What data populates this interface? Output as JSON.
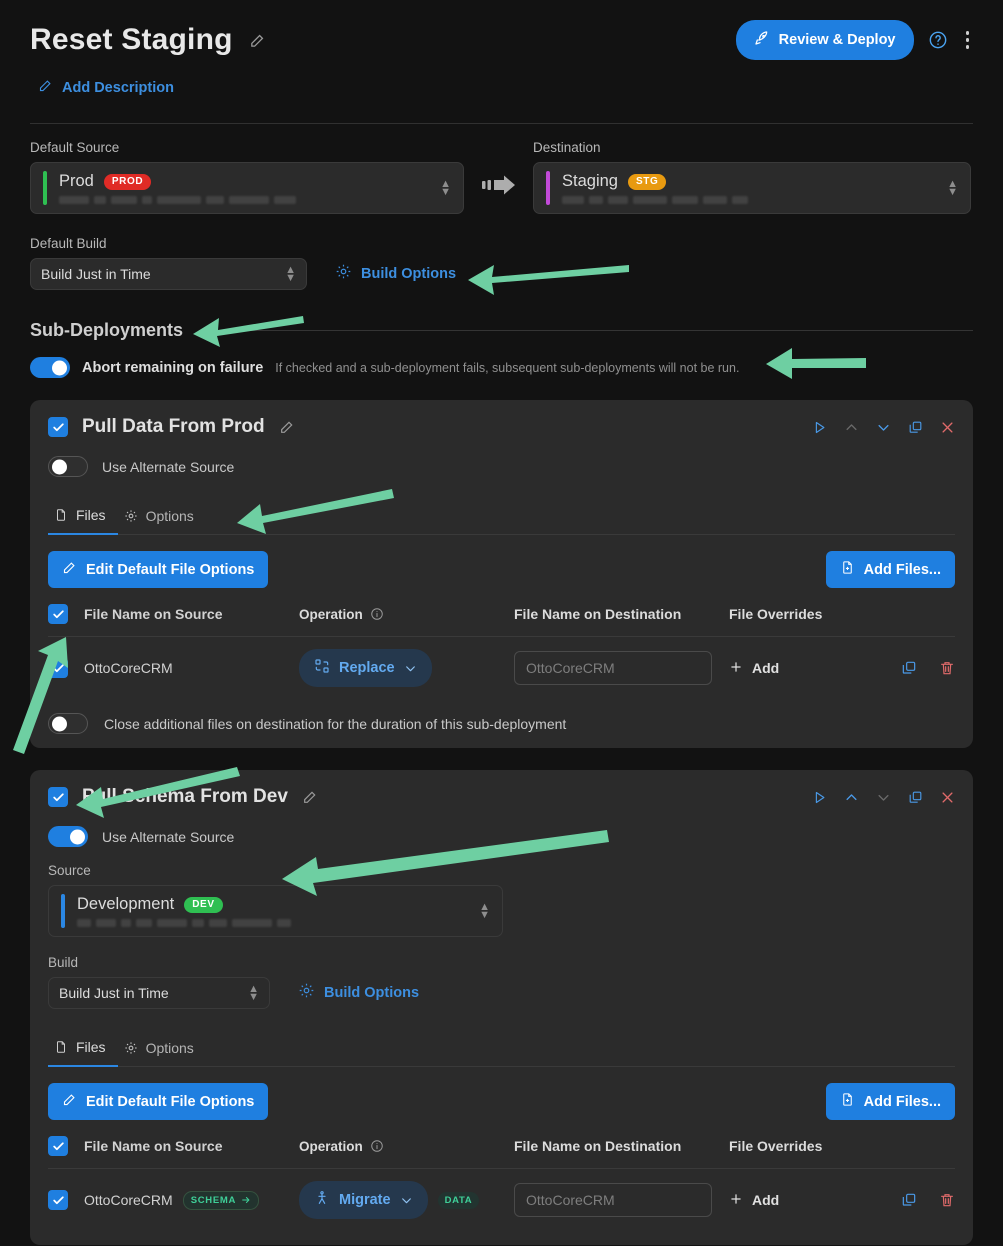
{
  "header": {
    "title": "Reset Staging",
    "edit_title_icon": "pencil-icon",
    "deploy_label": "Review & Deploy",
    "deploy_icon": "rocket-icon",
    "help_icon": "help-circle-icon",
    "menu_icon": "kebab-menu-icon",
    "add_description_label": "Add Description",
    "add_description_icon": "pencil-square-icon",
    "accent_color": "#1f7fe0"
  },
  "connection": {
    "source_label": "Default Source",
    "source": {
      "name": "Prod",
      "badge": "PROD",
      "badge_color": "#e02b26",
      "accent_color": "#2fbf52",
      "redacted": true
    },
    "arrow_icon": "arrow-right-motion-icon",
    "destination_label": "Destination",
    "destination": {
      "name": "Staging",
      "badge": "STG",
      "badge_color": "#e89a10",
      "accent_color": "#c24ad8",
      "redacted": true
    }
  },
  "default_build": {
    "label": "Default Build",
    "value": "Build Just in Time",
    "build_options_label": "Build Options",
    "build_options_icon": "gear-icon"
  },
  "sub_deployments": {
    "section_title": "Sub-Deployments",
    "abort": {
      "label": "Abort remaining on failure",
      "hint": "If checked and a sub-deployment fails, subsequent sub-deployments will not be run.",
      "enabled": true
    },
    "cards": [
      {
        "title": "Pull Data From Prod",
        "checked": true,
        "edit_icon": "pencil-icon",
        "actions": [
          {
            "name": "run-icon",
            "glyph": "play",
            "state": "enabled"
          },
          {
            "name": "move-up-icon",
            "glyph": "chevron-up",
            "state": "disabled"
          },
          {
            "name": "move-down-icon",
            "glyph": "chevron-down",
            "state": "enabled"
          },
          {
            "name": "duplicate-icon",
            "glyph": "copy",
            "state": "enabled"
          },
          {
            "name": "remove-icon",
            "glyph": "close",
            "state": "danger"
          }
        ],
        "alt_source": {
          "label": "Use Alternate Source",
          "enabled": false
        },
        "tabs": [
          {
            "label": "Files",
            "icon": "file-icon",
            "active": true
          },
          {
            "label": "Options",
            "icon": "gear-icon",
            "active": false
          }
        ],
        "edit_defaults_label": "Edit Default File Options",
        "edit_defaults_icon": "pencil-icon",
        "add_files_label": "Add Files...",
        "add_files_icon": "file-plus-icon",
        "table": {
          "header_checked": true,
          "columns": [
            "File Name on Source",
            "Operation",
            "File Name on Destination",
            "File Overrides"
          ],
          "operation_info_icon": "info-icon",
          "rows": [
            {
              "checked": true,
              "source_name": "OttoCoreCRM",
              "source_badge": null,
              "operation": "Replace",
              "operation_icon": "replace-icon",
              "operation_badge": null,
              "destination_placeholder": "OttoCoreCRM",
              "destination_value": "",
              "add_label": "Add",
              "add_icon": "plus-icon",
              "copy_icon": "copy-icon",
              "delete_icon": "trash-icon"
            }
          ]
        },
        "close_files": {
          "label": "Close additional files on destination for the duration of this sub-deployment",
          "enabled": false
        }
      },
      {
        "title": "Pull Schema From Dev",
        "checked": true,
        "edit_icon": "pencil-icon",
        "actions": [
          {
            "name": "run-icon",
            "glyph": "play",
            "state": "enabled"
          },
          {
            "name": "move-up-icon",
            "glyph": "chevron-up",
            "state": "enabled"
          },
          {
            "name": "move-down-icon",
            "glyph": "chevron-down",
            "state": "disabled"
          },
          {
            "name": "duplicate-icon",
            "glyph": "copy",
            "state": "enabled"
          },
          {
            "name": "remove-icon",
            "glyph": "close",
            "state": "danger"
          }
        ],
        "alt_source": {
          "label": "Use Alternate Source",
          "enabled": true
        },
        "source_label": "Source",
        "source": {
          "name": "Development",
          "badge": "DEV",
          "badge_color": "#2fbf52",
          "accent_color": "#2b87e3",
          "redacted": true
        },
        "build_label": "Build",
        "build_value": "Build Just in Time",
        "build_options_label": "Build Options",
        "build_options_icon": "gear-icon",
        "tabs": [
          {
            "label": "Files",
            "icon": "file-icon",
            "active": true
          },
          {
            "label": "Options",
            "icon": "gear-icon",
            "active": false
          }
        ],
        "edit_defaults_label": "Edit Default File Options",
        "edit_defaults_icon": "pencil-icon",
        "add_files_label": "Add Files...",
        "add_files_icon": "file-plus-icon",
        "table": {
          "header_checked": true,
          "columns": [
            "File Name on Source",
            "Operation",
            "File Name on Destination",
            "File Overrides"
          ],
          "operation_info_icon": "info-icon",
          "rows": [
            {
              "checked": true,
              "source_name": "OttoCoreCRM",
              "source_badge": "SCHEMA",
              "operation": "Migrate",
              "operation_icon": "migrate-icon",
              "operation_badge": "DATA",
              "destination_placeholder": "OttoCoreCRM",
              "destination_value": "",
              "add_label": "Add",
              "add_icon": "plus-icon",
              "copy_icon": "copy-icon",
              "delete_icon": "trash-icon"
            }
          ]
        }
      }
    ]
  },
  "annotations": {
    "color": "#6ecfa2",
    "arrows": [
      "points-to-build-options",
      "points-to-sub-deployments-heading",
      "points-to-abort-hint",
      "points-to-options-tab",
      "points-to-file-header-checkbox",
      "points-to-second-card-checkbox",
      "points-to-alternate-source"
    ]
  }
}
